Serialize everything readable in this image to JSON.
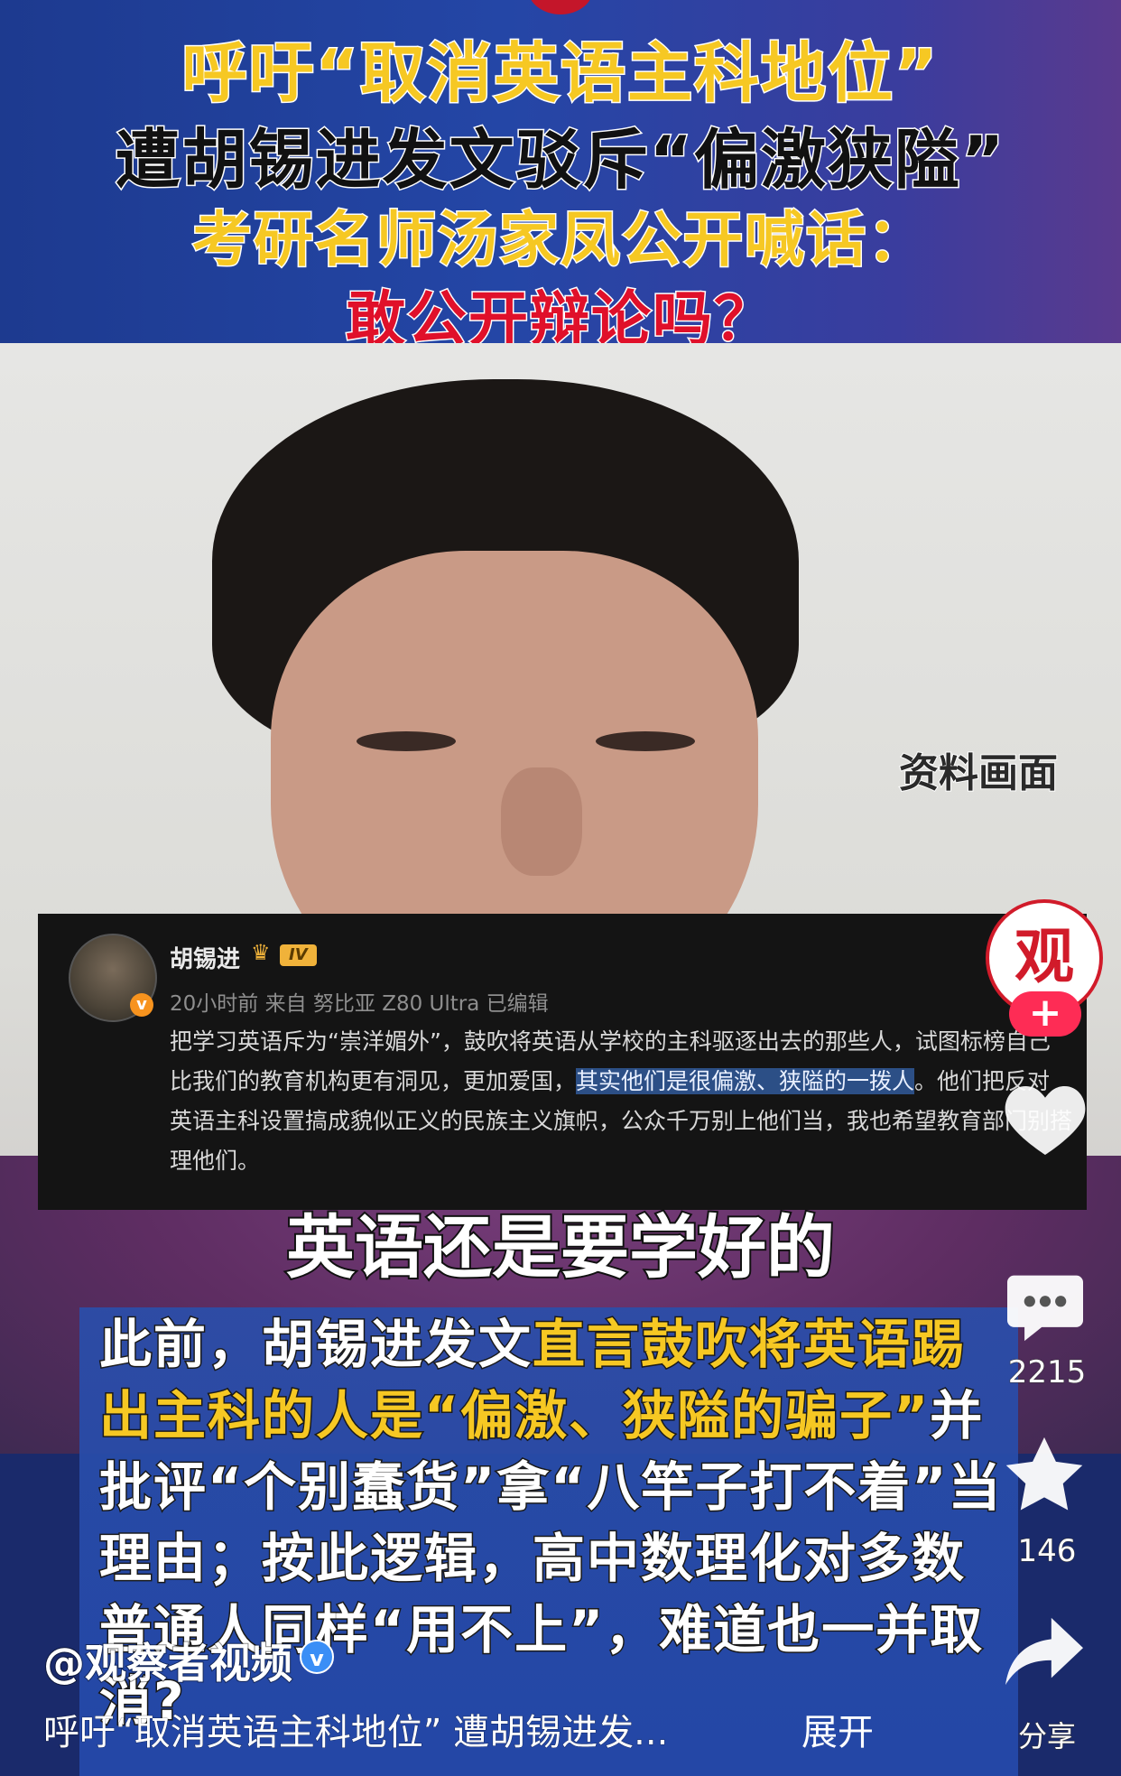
{
  "banner": {
    "line1": "呼吁“取消英语主科地位”",
    "line2": "遭胡锡进发文驳斥“偏激狭隘”",
    "line3": "考研名师汤家凤公开喊话：",
    "line4": "敢公开辩论吗？"
  },
  "video": {
    "watermark": "资料画面",
    "caption": "英语还是要学好的"
  },
  "weibo_post": {
    "author": "胡锡进",
    "level_badge": "IV",
    "meta": "20小时前 来自 努比亚 Z80 Ultra 已编辑",
    "text_before": "把学习英语斥为“崇洋媚外”，鼓吹将英语从学校的主科驱逐出去的那些人，试图标榜自己比我们的教育机构更有洞见，更加爱国，",
    "text_highlight": "其实他们是很偏激、狭隘的一拨人",
    "text_after": "。他们把反对英语主科设置搞成貌似正义的民族主义旗帜，公众千万别上他们当，我也希望教育部门别搭理他们。",
    "verified_mark": "v"
  },
  "summary": {
    "part1": "此前，胡锡进发文",
    "part2_highlight": "直言鼓吹将英语踢出主科的人是“偏激、狭隘的骗子”",
    "part3": "并批评“个别蠢货”拿“八竿子打不着”当理由；按此逻辑，高中数理化对多数普通人同样“用不上”，难道也一并取消?"
  },
  "sidebar": {
    "logo_text": "观",
    "follow_label": "+",
    "comment_count": "2215",
    "favorite_count": "146",
    "share_label": "分享"
  },
  "footer": {
    "account": "@观察者视频",
    "verified": "v",
    "caption": "呼吁“取消英语主科地位” 遭胡锡进发...",
    "expand": "展开"
  },
  "colors": {
    "banner_yellow": "#f6c823",
    "banner_red": "#e0102a",
    "follow_pink": "#fe2c55",
    "summary_blue": "#2a4eaa"
  }
}
